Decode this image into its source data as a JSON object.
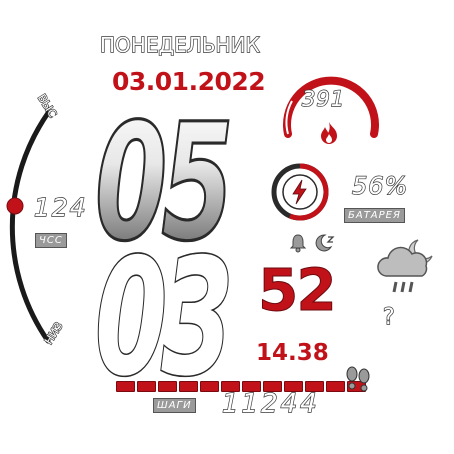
{
  "day_of_week": "ПОНЕДЕЛЬНИК",
  "date": "03.01.2022",
  "time": {
    "hours": "05",
    "minutes": "03",
    "seconds": "52"
  },
  "secondary_time": "14.38",
  "calories": {
    "value": "391",
    "progress": 0.75
  },
  "battery": {
    "percent": "56%",
    "label": "БАТАРЕЯ",
    "progress": 0.56
  },
  "heart_rate": {
    "value": "124",
    "label": "ЧСС",
    "high_label": "ВЫС",
    "low_label": "НИЗ",
    "level": 0.5
  },
  "steps": {
    "value": "11244",
    "label": "ШАГИ",
    "segments": 12
  },
  "weather": {
    "icon": "cloud-moon-rain-icon",
    "temperature": "?"
  },
  "colors": {
    "accent": "#c1121a",
    "dark": "#2a2a2a",
    "label_bg": "#9a9a9a"
  }
}
